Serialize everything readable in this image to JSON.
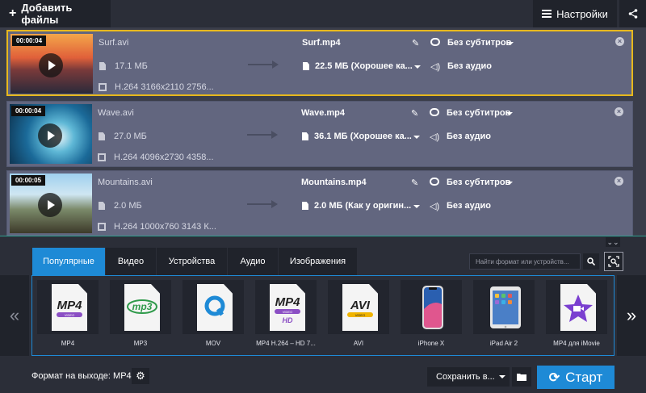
{
  "toolbar": {
    "add_files_label": "Добавить файлы",
    "settings_label": "Настройки"
  },
  "files": [
    {
      "duration": "00:00:04",
      "source_name": "Surf.avi",
      "source_size": "17.1 МБ",
      "source_codec": "H.264 3166x2110 2756...",
      "output_name": "Surf.mp4",
      "output_size": "22.5 МБ (Хорошее ка...",
      "subtitles": "Без субтитров",
      "audio": "Без аудио",
      "selected": true
    },
    {
      "duration": "00:00:04",
      "source_name": "Wave.avi",
      "source_size": "27.0 МБ",
      "source_codec": "H.264 4096x2730 4358...",
      "output_name": "Wave.mp4",
      "output_size": "36.1 МБ (Хорошее ка...",
      "subtitles": "Без субтитров",
      "audio": "Без аудио",
      "selected": false
    },
    {
      "duration": "00:00:05",
      "source_name": "Mountains.avi",
      "source_size": "2.0 МБ",
      "source_codec": "H.264 1000x760 3143 К...",
      "output_name": "Mountains.mp4",
      "output_size": "2.0 МБ (Как у оригин...",
      "subtitles": "Без субтитров",
      "audio": "Без аудио",
      "selected": false
    }
  ],
  "tabs": [
    {
      "label": "Популярные",
      "active": true
    },
    {
      "label": "Видео",
      "active": false
    },
    {
      "label": "Устройства",
      "active": false
    },
    {
      "label": "Аудио",
      "active": false
    },
    {
      "label": "Изображения",
      "active": false
    }
  ],
  "search": {
    "placeholder": "Найти формат или устройств..."
  },
  "formats": [
    {
      "label": "MP4",
      "icon": "mp4-icon"
    },
    {
      "label": "MP3",
      "icon": "mp3-icon"
    },
    {
      "label": "MOV",
      "icon": "mov-icon"
    },
    {
      "label": "MP4 H.264 – HD 7...",
      "icon": "mp4-hd-icon"
    },
    {
      "label": "AVI",
      "icon": "avi-icon"
    },
    {
      "label": "iPhone X",
      "icon": "iphone-icon"
    },
    {
      "label": "iPad Air 2",
      "icon": "ipad-icon"
    },
    {
      "label": "MP4 для iMovie",
      "icon": "imovie-icon"
    }
  ],
  "icon_texts": {
    "mp4": "MP4",
    "mp3": "mp3",
    "avi": "AVI",
    "video": "VIDEO",
    "hd": "HD"
  },
  "bottom": {
    "output_format": "Формат на выходе: MP4",
    "save_label": "Сохранить в...",
    "start_label": "Старт"
  },
  "colors": {
    "accent": "#1e8ad6",
    "selection": "#e7b81d",
    "row_bg": "#62667f"
  }
}
